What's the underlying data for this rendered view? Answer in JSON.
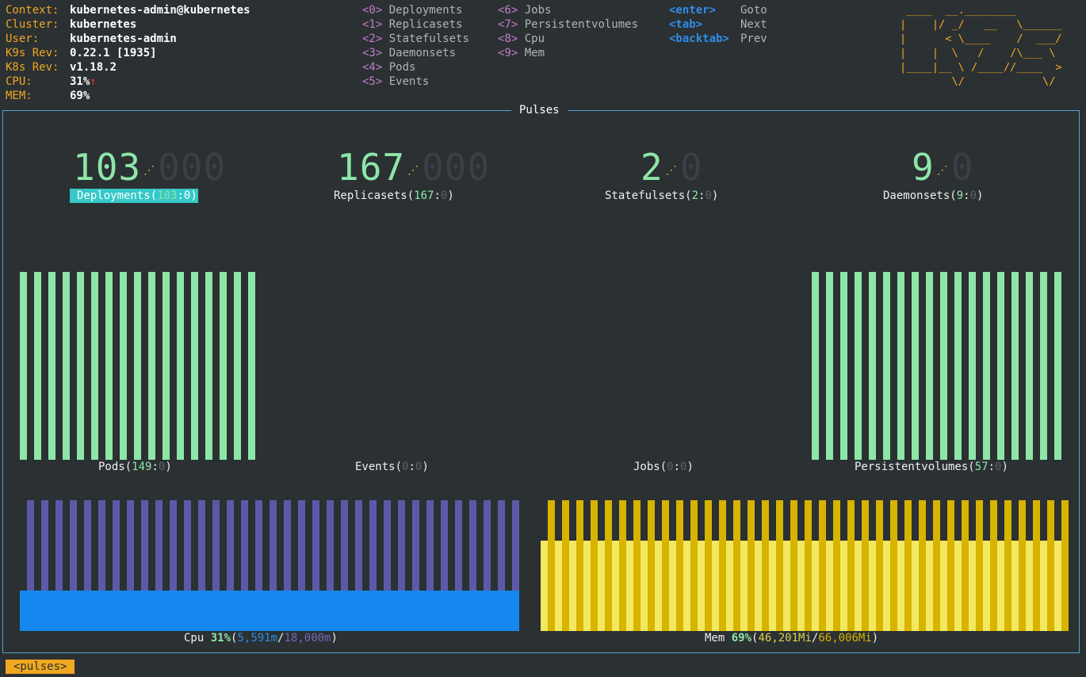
{
  "info": {
    "context_key": "Context:",
    "context": "kubernetes-admin@kubernetes",
    "cluster_key": "Cluster:",
    "cluster": "kubernetes",
    "user_key": "User:",
    "user": "kubernetes-admin",
    "k9s_key": "K9s Rev:",
    "k9s": "0.22.1 [1935]",
    "k8s_key": "K8s Rev:",
    "k8s": "v1.18.2",
    "cpu_key": "CPU:",
    "cpu": "31%",
    "cpu_trend": "↑",
    "mem_key": "MEM:",
    "mem": "69%"
  },
  "menu": [
    {
      "key": "<0>",
      "label": "Deployments"
    },
    {
      "key": "<1>",
      "label": "Replicasets"
    },
    {
      "key": "<2>",
      "label": "Statefulsets"
    },
    {
      "key": "<3>",
      "label": "Daemonsets"
    },
    {
      "key": "<4>",
      "label": "Pods"
    },
    {
      "key": "<5>",
      "label": "Events"
    },
    {
      "key": "<6>",
      "label": "Jobs"
    },
    {
      "key": "<7>",
      "label": "Persistentvolumes"
    },
    {
      "key": "<8>",
      "label": "Cpu"
    },
    {
      "key": "<9>",
      "label": "Mem"
    }
  ],
  "hotkeys": [
    {
      "key": "<enter>",
      "label": "Goto"
    },
    {
      "key": "<tab>",
      "label": "Next"
    },
    {
      "key": "<backtab>",
      "label": "Prev"
    }
  ],
  "logo": [
    " ____  __.________        ",
    "|    |/ _/   __   \\______ ",
    "|      < \\____    /  ___/ ",
    "|    |  \\   /    /\\___ \\  ",
    "|____|__ \\ /____//____  > ",
    "        \\/            \\/  "
  ],
  "panel_title": "Pulses",
  "gauges": [
    {
      "on": "103",
      "off": "000",
      "name": "Deployments",
      "ok": "103",
      "err": "0"
    },
    {
      "on": "167",
      "off": "000",
      "name": "Replicasets",
      "ok": "167",
      "err": "0"
    },
    {
      "on": "2",
      "off": "0",
      "name": "Statefulsets",
      "ok": "2",
      "err": "0"
    },
    {
      "on": "9",
      "off": "0",
      "name": "Daemonsets",
      "ok": "9",
      "err": "0"
    }
  ],
  "sparks": [
    {
      "name": "Pods",
      "ok": "149",
      "err": "0"
    },
    {
      "name": "Events",
      "ok": "0",
      "err": "0"
    },
    {
      "name": "Jobs",
      "ok": "0",
      "err": "0"
    },
    {
      "name": "Persistentvolumes",
      "ok": "57",
      "err": "0"
    }
  ],
  "cpu": {
    "name": "Cpu",
    "pct": "31%",
    "used": "5,591m",
    "total": "18,000m",
    "level": 0.31
  },
  "mem": {
    "name": "Mem",
    "pct": "69%",
    "used": "46,201Mi",
    "total": "66,006Mi",
    "level": 0.69
  },
  "colors": {
    "green": "#8de6a8",
    "purple": "#5c5aa8",
    "blue": "#1588f0",
    "gold": "#d6b400",
    "yellow": "#f4e860"
  },
  "crumb": "<pulses>"
}
